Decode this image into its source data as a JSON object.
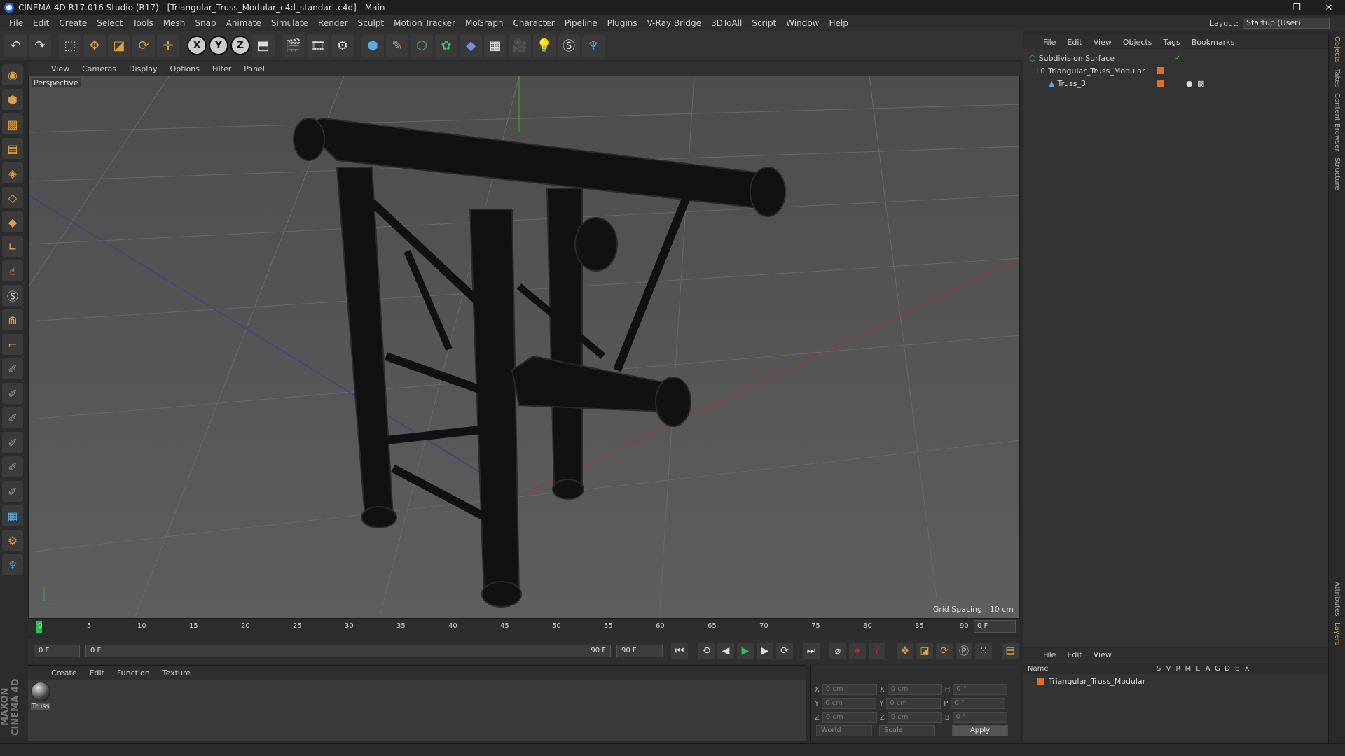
{
  "titlebar": {
    "title": "CINEMA 4D R17.016 Studio (R17) - [Triangular_Truss_Modular_c4d_standart.c4d] - Main",
    "minimize": "–",
    "restore": "❐",
    "close": "✕"
  },
  "menubar": {
    "items": [
      "File",
      "Edit",
      "Create",
      "Select",
      "Tools",
      "Mesh",
      "Snap",
      "Animate",
      "Simulate",
      "Render",
      "Sculpt",
      "Motion Tracker",
      "MoGraph",
      "Character",
      "Pipeline",
      "Plugins",
      "V-Ray Bridge",
      "3DToAll",
      "Script",
      "Window",
      "Help"
    ],
    "layout_label": "Layout:",
    "layout_value": "Startup (User)"
  },
  "toolbar": {
    "x_axis": "X",
    "y_axis": "Y",
    "z_axis": "Z"
  },
  "viewport": {
    "menu": [
      "View",
      "Cameras",
      "Display",
      "Options",
      "Filter",
      "Panel"
    ],
    "label": "Perspective",
    "grid_spacing": "Grid Spacing : 10 cm"
  },
  "timeline": {
    "ticks": [
      "0",
      "5",
      "10",
      "15",
      "20",
      "25",
      "30",
      "35",
      "40",
      "45",
      "50",
      "55",
      "60",
      "65",
      "70",
      "75",
      "80",
      "85",
      "90"
    ],
    "current_frame": "0 F"
  },
  "transport": {
    "start_field": "0 F",
    "range_start": "0 F",
    "range_end": "90 F",
    "end_field": "90 F"
  },
  "material_manager": {
    "menu": [
      "Create",
      "Edit",
      "Function",
      "Texture"
    ],
    "material_name": "Truss"
  },
  "coordinates": {
    "rows": [
      {
        "a": "X",
        "av": "0 cm",
        "b": "X",
        "bv": "0 cm",
        "c": "H",
        "cv": "0 °"
      },
      {
        "a": "Y",
        "av": "0 cm",
        "b": "Y",
        "bv": "0 cm",
        "c": "P",
        "cv": "0 °"
      },
      {
        "a": "Z",
        "av": "0 cm",
        "b": "Z",
        "bv": "0 cm",
        "c": "B",
        "cv": "0 °"
      }
    ],
    "mode": "World",
    "scale": "Scale",
    "apply": "Apply"
  },
  "object_manager": {
    "menu": [
      "File",
      "Edit",
      "View",
      "Objects",
      "Tags",
      "Bookmarks"
    ],
    "objects": [
      {
        "name": "Subdivision Surface"
      },
      {
        "name": "Triangular_Truss_Modular"
      },
      {
        "name": "Truss_3"
      }
    ]
  },
  "layer_manager": {
    "menu": [
      "File",
      "Edit",
      "View"
    ],
    "headers": [
      "Name",
      "S",
      "V",
      "R",
      "M",
      "L",
      "A",
      "G",
      "D",
      "E",
      "X"
    ],
    "layer_name": "Triangular_Truss_Modular"
  },
  "side_tabs": [
    "Objects",
    "Takes",
    "Content Browser",
    "Structure",
    "Attributes",
    "Layers"
  ],
  "maxon_logo": "MAXON CINEMA 4D",
  "colors": {
    "accent": "#e07020",
    "play": "#30c050",
    "record": "#d02020"
  }
}
